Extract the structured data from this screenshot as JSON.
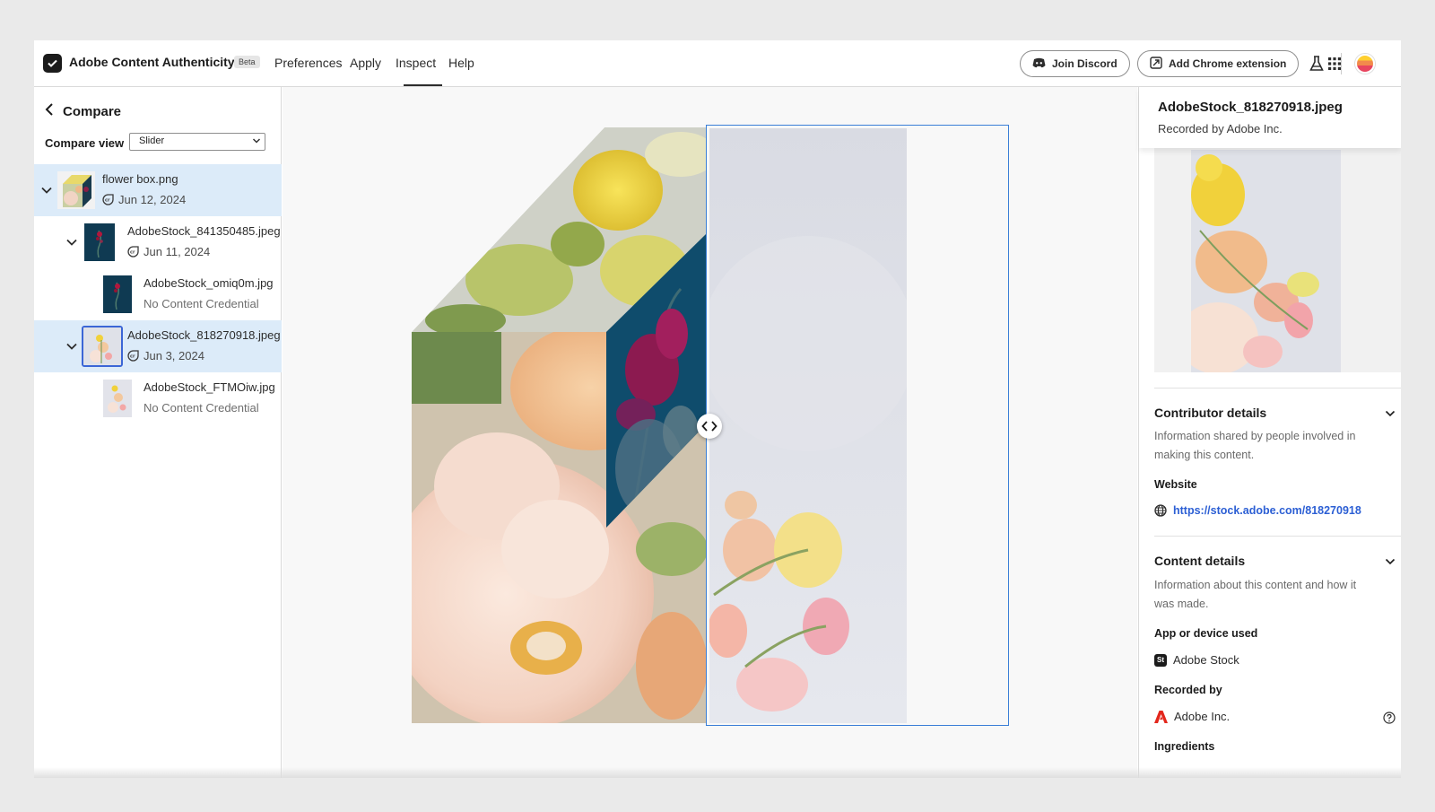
{
  "header": {
    "app_title": "Adobe Content Authenticity",
    "beta_badge": "Beta",
    "nav": [
      "Preferences",
      "Apply",
      "Inspect",
      "Help"
    ],
    "active_nav": "Inspect",
    "discord_label": "Join Discord",
    "chrome_label": "Add Chrome extension"
  },
  "left_panel": {
    "back_label": "Compare",
    "compare_view_label": "Compare view",
    "compare_view_value": "Slider",
    "tree": [
      {
        "name": "flower box.png",
        "sub": "Jun 12, 2024",
        "has_credential": true,
        "expanded": true,
        "selected": true
      },
      {
        "name": "AdobeStock_841350485.jpeg",
        "sub": "Jun 11, 2024",
        "has_credential": true,
        "expanded": true,
        "selected": false
      },
      {
        "name": "AdobeStock_omiq0m.jpg",
        "sub": "No Content Credential",
        "has_credential": false,
        "expanded": false,
        "selected": false
      },
      {
        "name": "AdobeStock_818270918.jpeg",
        "sub": "Jun 3, 2024",
        "has_credential": true,
        "expanded": true,
        "selected": true
      },
      {
        "name": "AdobeStock_FTMOiw.jpg",
        "sub": "No Content Credential",
        "has_credential": false,
        "expanded": false,
        "selected": false
      }
    ]
  },
  "right_panel": {
    "title": "AdobeStock_818270918.jpeg",
    "recorded_by_line": "Recorded by Adobe Inc.",
    "contributor": {
      "heading": "Contributor details",
      "description": "Information shared by people involved in making this content.",
      "website_label": "Website",
      "website_url": "https://stock.adobe.com/818270918"
    },
    "content": {
      "heading": "Content details",
      "description": "Information about this content and how it was made.",
      "app_label": "App or device used",
      "app_value": "Adobe Stock",
      "app_badge": "St",
      "recorded_label": "Recorded by",
      "recorded_value": "Adobe Inc.",
      "ingredients_label": "Ingredients"
    }
  },
  "colors": {
    "accent": "#3b7fd7",
    "selection": "#dcebf9",
    "link": "#2c5fd4"
  }
}
